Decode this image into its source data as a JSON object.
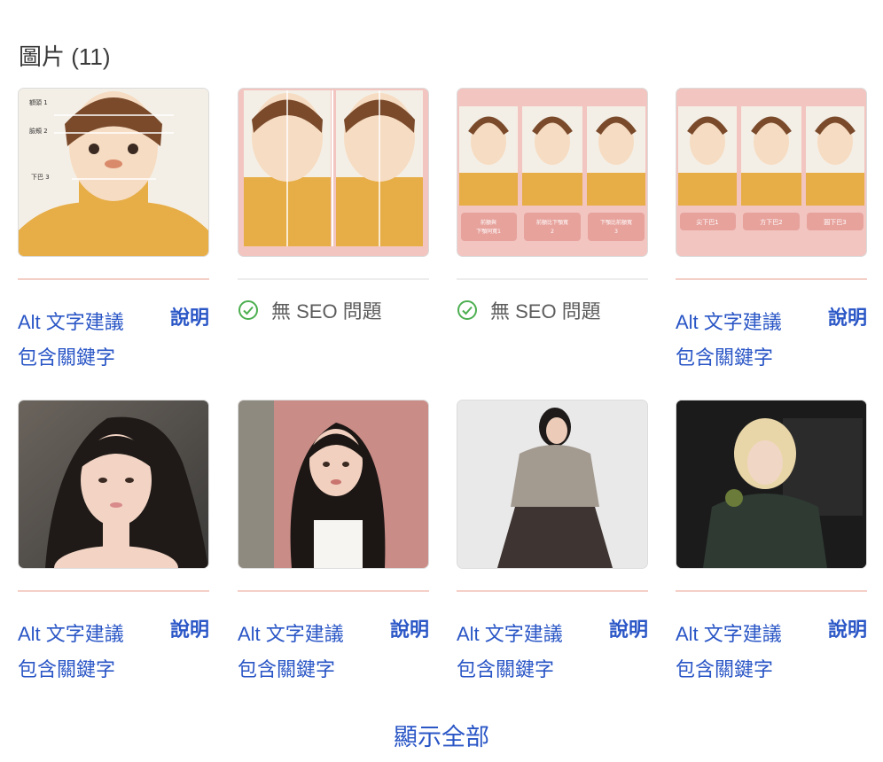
{
  "section": {
    "title": "圖片 (11)"
  },
  "images": [
    {
      "kind": "diagram-face",
      "status": "issue",
      "alt_label": "Alt 文字建議\n包含關鍵字",
      "help_label": "說明",
      "thumb_texts": [
        "額頭 1",
        "臉頰 2",
        "下巴 3"
      ]
    },
    {
      "kind": "diagram-two",
      "status": "ok",
      "ok_label": "無 SEO 問題"
    },
    {
      "kind": "diagram-three-pink",
      "status": "ok",
      "ok_label": "無 SEO 問題",
      "thumb_texts": [
        "前額與\n下顎同寬1",
        "前額比下顎寬\n2",
        "下顎比前額寬\n3"
      ]
    },
    {
      "kind": "diagram-three-chin",
      "status": "issue",
      "alt_label": "Alt 文字建議\n包含關鍵字",
      "help_label": "說明",
      "thumb_texts": [
        "尖下巴1",
        "方下巴2",
        "圓下巴3"
      ]
    },
    {
      "kind": "photo-1",
      "status": "issue",
      "alt_label": "Alt 文字建議\n包含關鍵字",
      "help_label": "說明"
    },
    {
      "kind": "photo-2",
      "status": "issue",
      "alt_label": "Alt 文字建議\n包含關鍵字",
      "help_label": "說明"
    },
    {
      "kind": "photo-3",
      "status": "issue",
      "alt_label": "Alt 文字建議\n包含關鍵字",
      "help_label": "說明"
    },
    {
      "kind": "photo-4",
      "status": "issue",
      "alt_label": "Alt 文字建議\n包含關鍵字",
      "help_label": "說明"
    }
  ],
  "footer": {
    "show_all": "顯示全部"
  },
  "colors": {
    "accent": "#2a56c6",
    "ok_green": "#4caf50",
    "divider_pink": "#f4cfc7"
  }
}
